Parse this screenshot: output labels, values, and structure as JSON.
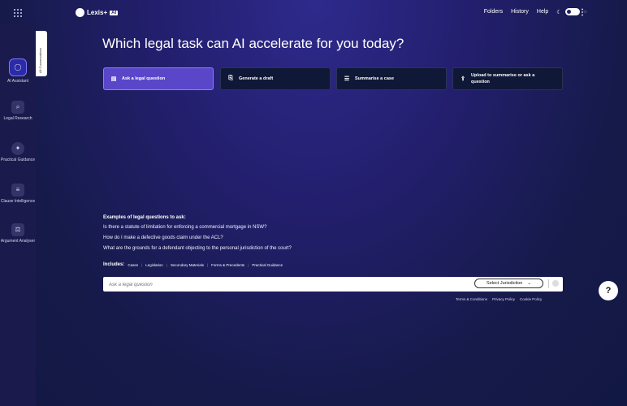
{
  "header": {
    "brand": "Lexis+",
    "brand_badge": "AI",
    "nav": [
      "Folders",
      "History",
      "Help"
    ],
    "more_icon": "⋮"
  },
  "sidebar": {
    "items": [
      {
        "label": "AI Assistant",
        "icon": "chat-bubble-icon",
        "active": true
      },
      {
        "label": "Legal Research",
        "icon": "search-document-icon"
      },
      {
        "label": "Practical Guidance",
        "icon": "compass-icon"
      },
      {
        "label": "Clause Intelligence",
        "icon": "document-sparkle-icon"
      },
      {
        "label": "Argument Analyser",
        "icon": "gavel-icon"
      }
    ],
    "conversations_tab": "All Conversations"
  },
  "main": {
    "headline": "Which legal task can AI accelerate for you today?",
    "tasks": [
      {
        "label": "Ask a legal question",
        "icon": "chat-icon",
        "active": true
      },
      {
        "label": "Generate a draft",
        "icon": "draft-icon"
      },
      {
        "label": "Summarise a case",
        "icon": "list-icon"
      },
      {
        "label": "Upload to summarise or ask a question",
        "icon": "upload-icon"
      }
    ],
    "examples": {
      "title": "Examples of legal questions to ask:",
      "questions": [
        "Is there a statute of limitation for enforcing a commercial mortgage in NSW?",
        "How do I make a defective goods claim under the ACL?",
        "What are the grounds for a defendant objecting to the personal jurisdiction of the court?"
      ]
    },
    "includes": {
      "label": "Includes:",
      "items": [
        "Cases",
        "Legislation",
        "Secondary Materials",
        "Forms & Precedents",
        "Practical Guidance"
      ]
    },
    "ask": {
      "placeholder": "Ask a legal question",
      "jurisdiction_button": "Select Jurisdiction"
    },
    "footer_links": [
      "Terms & Conditions",
      "Privacy Policy",
      "Cookie Policy"
    ],
    "help_label": "?"
  },
  "colors": {
    "background": "#231f6e",
    "accent": "#5946c8",
    "sidebar": "#1a1b4c"
  }
}
